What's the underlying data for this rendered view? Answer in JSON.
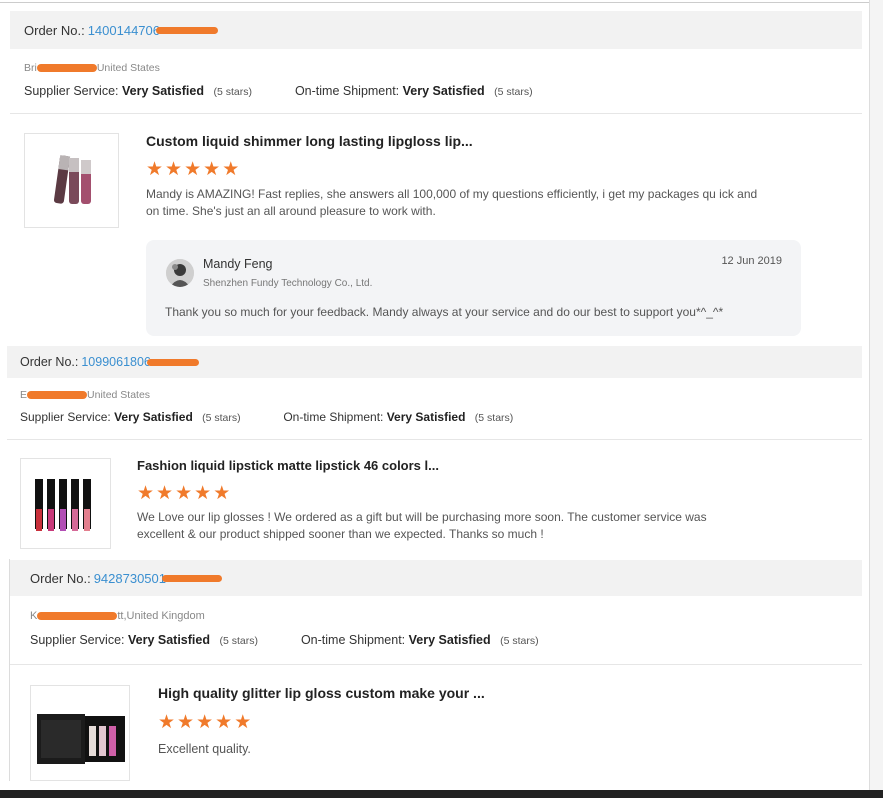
{
  "orders": [
    {
      "order_label": "Order No.:",
      "order_number": "1400144706",
      "location_country": "United States",
      "supplier_label": "Supplier Service:",
      "supplier_value": "Very Satisfied",
      "supplier_stars": "(5 stars)",
      "shipment_label": "On-time Shipment:",
      "shipment_value": "Very Satisfied",
      "shipment_stars": "(5 stars)",
      "product_title": "Custom liquid shimmer long lasting lipgloss lip...",
      "rating": 5,
      "review": "Mandy is AMAZING! Fast replies, she answers all 100,000 of my questions efficiently, i get my packages qu ick and on time. She's just an all around pleasure to work with.",
      "reply": {
        "name": "Mandy Feng",
        "company": "Shenzhen Fundy Technology Co., Ltd.",
        "date": "12 Jun 2019",
        "message": "Thank you so much for your feedback. Mandy always at your service and do our best to support you*^_^*"
      }
    },
    {
      "order_label": "Order No.:",
      "order_number": "1099061806",
      "location_country": "United States",
      "supplier_label": "Supplier Service:",
      "supplier_value": "Very Satisfied",
      "supplier_stars": "(5 stars)",
      "shipment_label": "On-time Shipment:",
      "shipment_value": "Very Satisfied",
      "shipment_stars": "(5 stars)",
      "product_title": "Fashion liquid lipstick matte lipstick 46 colors l...",
      "rating": 5,
      "review": "We Love our lip glosses ! We ordered as a gift but will be purchasing more soon. The customer service was excellent & our product shipped sooner than we expected. Thanks so much !"
    },
    {
      "order_label": "Order No.:",
      "order_number": "9428730501",
      "location_country": ",United Kingdom",
      "supplier_label": "Supplier Service:",
      "supplier_value": "Very Satisfied",
      "supplier_stars": "(5 stars)",
      "shipment_label": "On-time Shipment:",
      "shipment_value": "Very Satisfied",
      "shipment_stars": "(5 stars)",
      "product_title": "High quality glitter lip gloss custom make your ...",
      "rating": 5,
      "review": "Excellent quality."
    }
  ],
  "colors": {
    "accent": "#f07a2b",
    "link": "#3a8fd0",
    "header_bg": "#f2f2f2"
  },
  "icons": [
    "star-icon",
    "avatar-icon"
  ]
}
